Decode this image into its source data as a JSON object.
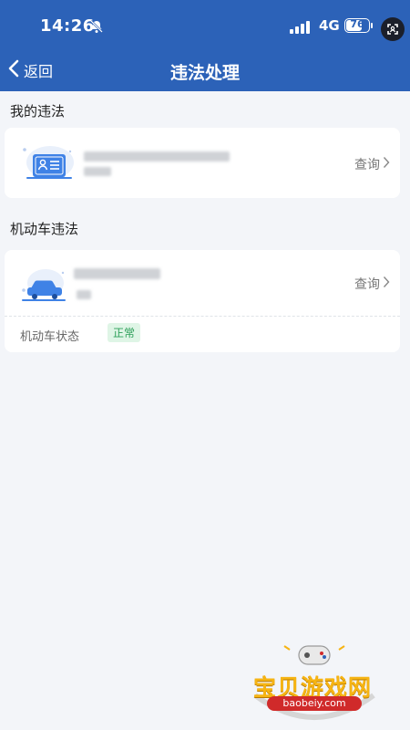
{
  "status_bar": {
    "time": "14:26",
    "network": "4G",
    "battery": "76",
    "battery_level": 0.76
  },
  "nav": {
    "back_label": "返回",
    "title": "违法处理"
  },
  "my_violations": {
    "section_title": "我的违法",
    "query_label": "查询"
  },
  "vehicle_violations": {
    "section_title": "机动车违法",
    "query_label": "查询",
    "status_label": "机动车状态",
    "status_value": "正常"
  },
  "colors": {
    "header": "#2c62b8",
    "background": "#f3f5f9",
    "accent": "#2c62b8",
    "badge_text": "#2ea05a",
    "badge_bg": "#dff5e6"
  },
  "watermark": {
    "text": "宝贝游戏网",
    "url": "baobeiy.com"
  }
}
